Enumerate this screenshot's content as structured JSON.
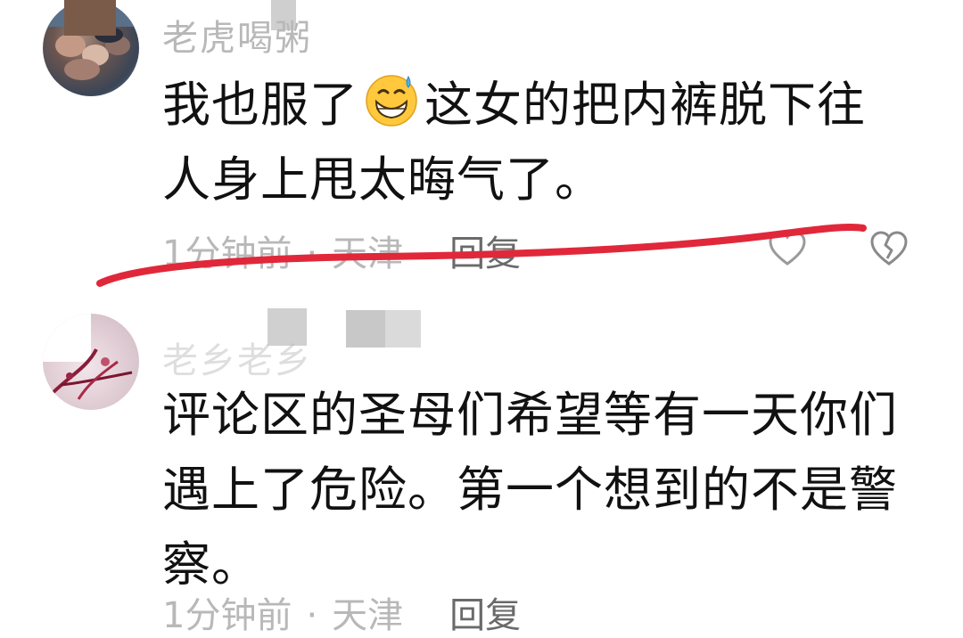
{
  "comments": [
    {
      "username": "老虎喝粥",
      "text_before_emoji": "我也服了",
      "emoji": "grinning-sweat-emoji",
      "text_after_emoji": "这女的把内裤脱下往人身上甩太晦气了。",
      "time": "1分钟前",
      "separator": "·",
      "location": "天津",
      "reply_label": "回复"
    },
    {
      "username": "老乡老乡",
      "text": "评论区的圣母们希望等有一天你们遇上了危险。第一个想到的不是警察。",
      "time": "1分钟前",
      "separator": "·",
      "location": "天津",
      "reply_label": "回复"
    }
  ],
  "annotation": {
    "color": "#e0283a"
  },
  "icons": {
    "like": "heart-outline-icon",
    "dislike": "broken-heart-icon"
  }
}
